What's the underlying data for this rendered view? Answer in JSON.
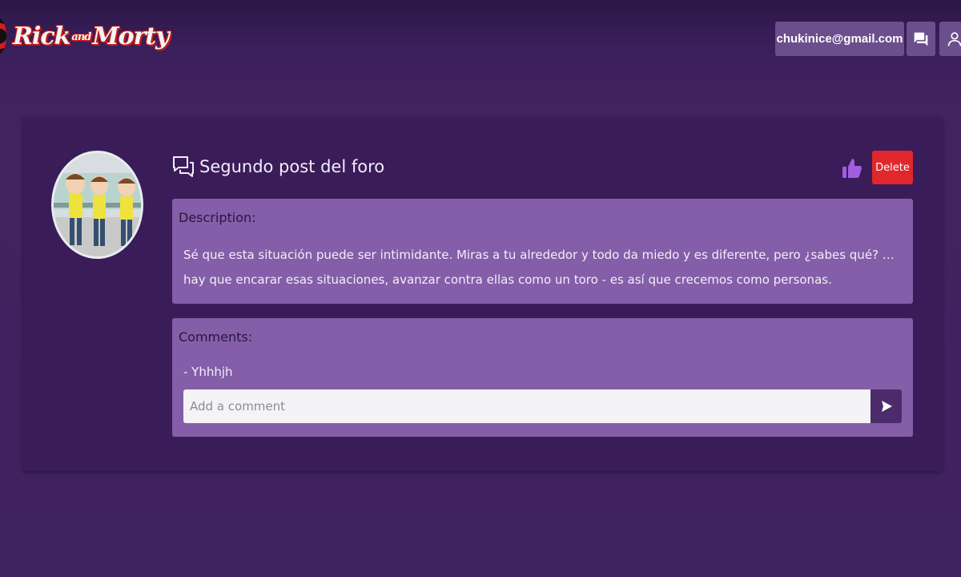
{
  "header": {
    "logo_text_rick": "Rick",
    "logo_text_and": "and",
    "logo_text_morty": "Morty",
    "user_email": "chukinice@gmail.com",
    "icons": [
      "forum-icon",
      "user-icon"
    ]
  },
  "post": {
    "title": "Segundo post del foro",
    "delete_label": "Delete",
    "description_label": "Description:",
    "description_text": "Sé que esta situación puede ser intimidante. Miras a tu alrededor y todo da miedo y es diferente, pero ¿sabes qué? … hay que encarar esas situaciones, avanzar contra ellas como un toro - es así que crecemos como personas.",
    "comments_label": "Comments:",
    "comments": [
      "- Yhhhjh"
    ],
    "comment_placeholder": "Add a comment"
  },
  "colors": {
    "background": "#3f2260",
    "card": "#3a1c59",
    "panel": "#845ea8",
    "accent": "#6b4f8c",
    "delete": "#e0272c",
    "like": "#a15ee0"
  }
}
